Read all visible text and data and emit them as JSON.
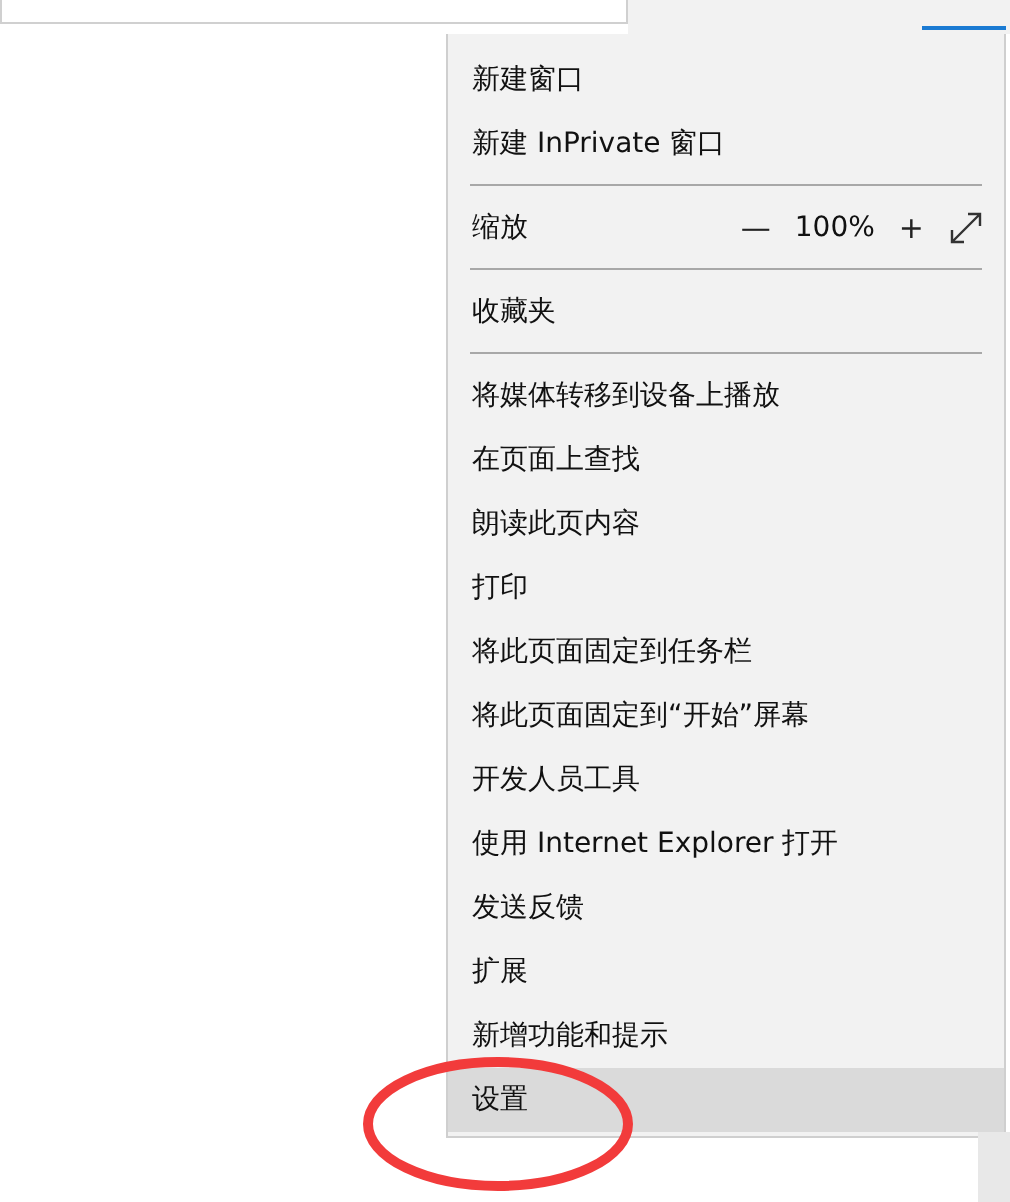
{
  "menu": {
    "items": [
      {
        "kind": "item",
        "label": "新建窗口",
        "selected": false
      },
      {
        "kind": "item",
        "label": "新建 InPrivate 窗口",
        "selected": false
      },
      {
        "kind": "separator"
      },
      {
        "kind": "zoom",
        "label": "缩放",
        "minus": "—",
        "value": "100%",
        "plus": "+"
      },
      {
        "kind": "separator"
      },
      {
        "kind": "item",
        "label": "收藏夹",
        "selected": false
      },
      {
        "kind": "separator"
      },
      {
        "kind": "item",
        "label": "将媒体转移到设备上播放",
        "selected": false
      },
      {
        "kind": "item",
        "label": "在页面上查找",
        "selected": false
      },
      {
        "kind": "item",
        "label": "朗读此页内容",
        "selected": false
      },
      {
        "kind": "item",
        "label": "打印",
        "selected": false
      },
      {
        "kind": "item",
        "label": "将此页面固定到任务栏",
        "selected": false
      },
      {
        "kind": "item",
        "label": "将此页面固定到“开始”屏幕",
        "selected": false
      },
      {
        "kind": "item",
        "label": "开发人员工具",
        "selected": false
      },
      {
        "kind": "item",
        "label": "使用 Internet Explorer 打开",
        "selected": false
      },
      {
        "kind": "item",
        "label": "发送反馈",
        "selected": false
      },
      {
        "kind": "item",
        "label": "扩展",
        "selected": false
      },
      {
        "kind": "item",
        "label": "新增功能和提示",
        "selected": false
      },
      {
        "kind": "item",
        "label": "设置",
        "selected": true
      }
    ]
  }
}
